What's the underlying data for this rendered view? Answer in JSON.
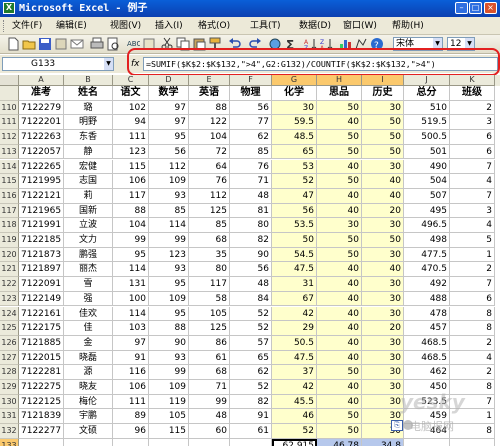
{
  "window": {
    "title": "Microsoft Excel - 例子"
  },
  "menu": [
    "文件(F)",
    "编辑(E)",
    "视图(V)",
    "插入(I)",
    "格式(O)",
    "工具(T)",
    "数据(D)",
    "窗口(W)",
    "帮助(H)"
  ],
  "toolbar": {
    "icons": [
      "new-icon",
      "open-icon",
      "save-icon",
      "permission-icon",
      "email-icon",
      "print-icon",
      "preview-icon",
      "spell-icon",
      "research-icon",
      "cut-icon",
      "copy-icon",
      "paste-icon",
      "format-painter-icon",
      "undo-icon",
      "redo-icon",
      "hyperlink-icon",
      "autosum-icon",
      "sort-asc-icon",
      "sort-desc-icon",
      "chart-icon",
      "drawing-icon",
      "zoom-icon",
      "help-icon"
    ],
    "font": "宋体",
    "font_size": "12"
  },
  "formula": {
    "cell_ref": "G133",
    "fx_label": "fx",
    "content": "=SUMIF($K$2:$K$132,\">4\",G2:G132)/COUNTIF($K$2:$K$132,\">4\")"
  },
  "columns": [
    "A",
    "B",
    "C",
    "D",
    "E",
    "F",
    "G",
    "H",
    "I",
    "J",
    "K"
  ],
  "headers": [
    "准考",
    "姓名",
    "语文",
    "数学",
    "英语",
    "物理",
    "化学",
    "思品",
    "历史",
    "总分",
    "班级"
  ],
  "rows": [
    {
      "n": "110",
      "c": [
        "7122279",
        "璐",
        "102",
        "97",
        "88",
        "56",
        "30",
        "50",
        "30",
        "510",
        "2"
      ]
    },
    {
      "n": "111",
      "c": [
        "7122201",
        "明野",
        "94",
        "97",
        "122",
        "77",
        "59.5",
        "40",
        "50",
        "519.5",
        "3"
      ]
    },
    {
      "n": "112",
      "c": [
        "7122263",
        "东香",
        "111",
        "95",
        "104",
        "62",
        "48.5",
        "50",
        "50",
        "500.5",
        "6"
      ]
    },
    {
      "n": "113",
      "c": [
        "7122057",
        "静",
        "123",
        "56",
        "72",
        "85",
        "65",
        "50",
        "50",
        "501",
        "6"
      ]
    },
    {
      "n": "114",
      "c": [
        "7122265",
        "宏健",
        "115",
        "112",
        "64",
        "76",
        "53",
        "40",
        "30",
        "490",
        "7"
      ]
    },
    {
      "n": "115",
      "c": [
        "7121995",
        "志国",
        "106",
        "109",
        "76",
        "71",
        "52",
        "50",
        "40",
        "504",
        "4"
      ]
    },
    {
      "n": "116",
      "c": [
        "7122121",
        "莉",
        "117",
        "93",
        "112",
        "48",
        "47",
        "40",
        "40",
        "507",
        "7"
      ]
    },
    {
      "n": "117",
      "c": [
        "7121965",
        "国新",
        "88",
        "85",
        "125",
        "81",
        "56",
        "40",
        "20",
        "495",
        "3"
      ]
    },
    {
      "n": "118",
      "c": [
        "7121991",
        "立波",
        "104",
        "114",
        "85",
        "80",
        "53.5",
        "30",
        "30",
        "496.5",
        "4"
      ]
    },
    {
      "n": "119",
      "c": [
        "7122185",
        "文力",
        "99",
        "99",
        "68",
        "82",
        "50",
        "50",
        "50",
        "498",
        "5"
      ]
    },
    {
      "n": "120",
      "c": [
        "7121873",
        "鹏强",
        "95",
        "123",
        "35",
        "90",
        "54.5",
        "50",
        "30",
        "477.5",
        "1"
      ]
    },
    {
      "n": "121",
      "c": [
        "7121897",
        "丽杰",
        "114",
        "93",
        "80",
        "56",
        "47.5",
        "40",
        "40",
        "470.5",
        "2"
      ]
    },
    {
      "n": "122",
      "c": [
        "7122091",
        "雪",
        "131",
        "95",
        "117",
        "48",
        "31",
        "40",
        "30",
        "492",
        "7"
      ]
    },
    {
      "n": "123",
      "c": [
        "7122149",
        "强",
        "100",
        "109",
        "58",
        "84",
        "67",
        "40",
        "30",
        "488",
        "6"
      ]
    },
    {
      "n": "124",
      "c": [
        "7122161",
        "佳欢",
        "114",
        "95",
        "105",
        "52",
        "42",
        "40",
        "30",
        "478",
        "8"
      ]
    },
    {
      "n": "125",
      "c": [
        "7122175",
        "佳",
        "103",
        "88",
        "125",
        "52",
        "29",
        "40",
        "20",
        "457",
        "8"
      ]
    },
    {
      "n": "126",
      "c": [
        "7121885",
        "金",
        "97",
        "90",
        "86",
        "57",
        "50.5",
        "40",
        "30",
        "468.5",
        "2"
      ]
    },
    {
      "n": "127",
      "c": [
        "7122015",
        "晓磊",
        "91",
        "93",
        "61",
        "65",
        "47.5",
        "40",
        "30",
        "468.5",
        "4"
      ]
    },
    {
      "n": "128",
      "c": [
        "7122281",
        "源",
        "116",
        "99",
        "68",
        "62",
        "37",
        "50",
        "30",
        "462",
        "2"
      ]
    },
    {
      "n": "129",
      "c": [
        "7122275",
        "晓友",
        "106",
        "109",
        "71",
        "52",
        "42",
        "40",
        "30",
        "450",
        "8"
      ]
    },
    {
      "n": "130",
      "c": [
        "7122125",
        "梅伦",
        "111",
        "119",
        "99",
        "82",
        "45.5",
        "40",
        "30",
        "523.5",
        "7"
      ]
    },
    {
      "n": "131",
      "c": [
        "7121839",
        "宇鹏",
        "89",
        "105",
        "48",
        "91",
        "46",
        "50",
        "30",
        "459",
        "1"
      ]
    },
    {
      "n": "132",
      "c": [
        "7122277",
        "文硕",
        "96",
        "115",
        "60",
        "61",
        "52",
        "50",
        "30",
        "464",
        "8"
      ]
    }
  ],
  "result_row": {
    "n": "133",
    "g": "62.915",
    "h": "46.78",
    "i": "34.8"
  },
  "blank_row": {
    "n": "134"
  },
  "selected_columns": [
    "G",
    "H",
    "I"
  ],
  "watermark": {
    "brand": "yesky",
    "text": "电脑报网"
  }
}
